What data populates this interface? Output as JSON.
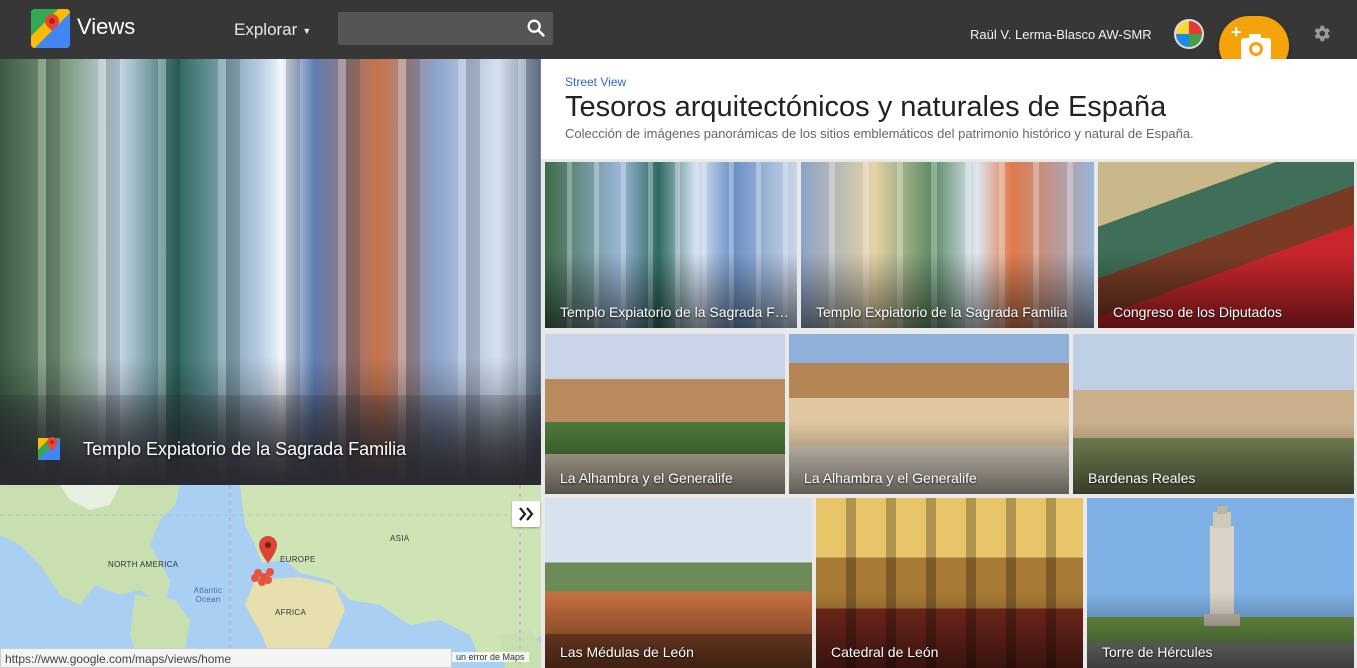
{
  "app": {
    "title": "Views",
    "explore_label": "Explorar",
    "search_placeholder": ""
  },
  "user": {
    "name": "Raül V. Lerma-Blasco AW-SMR"
  },
  "hero": {
    "caption": "Templo Expiatorio de la Sagrada Familia"
  },
  "map": {
    "labels": {
      "north_america": "NORTH AMERICA",
      "europe": "EUROPE",
      "asia": "ASIA",
      "africa": "AFRICA",
      "atlantic": "Atlantic Ocean"
    },
    "status_url": "https://www.google.com/maps/views/home",
    "report_text": "un error de Maps"
  },
  "collection": {
    "kicker": "Street View",
    "title": "Tesoros arquitectónicos y naturales de España",
    "subtitle": "Colección de imágenes panorámicas de los sitios emblemáticos del patrimonio histórico y natural de España."
  },
  "tiles": [
    {
      "caption": "Templo Expiatorio de la Sagrada Familia"
    },
    {
      "caption": "Templo Expiatorio de la Sagrada Familia"
    },
    {
      "caption": "Congreso de los Diputados"
    },
    {
      "caption": "La Alhambra y el Generalife"
    },
    {
      "caption": "La Alhambra y el Generalife"
    },
    {
      "caption": "Bardenas Reales"
    },
    {
      "caption": "Las Médulas de León"
    },
    {
      "caption": "Catedral de León"
    },
    {
      "caption": "Torre de Hércules"
    }
  ],
  "colors": {
    "topbar": "#373737",
    "accent_fab": "#f5a30b",
    "link": "#3367d6",
    "selection": "#4a89f3"
  }
}
